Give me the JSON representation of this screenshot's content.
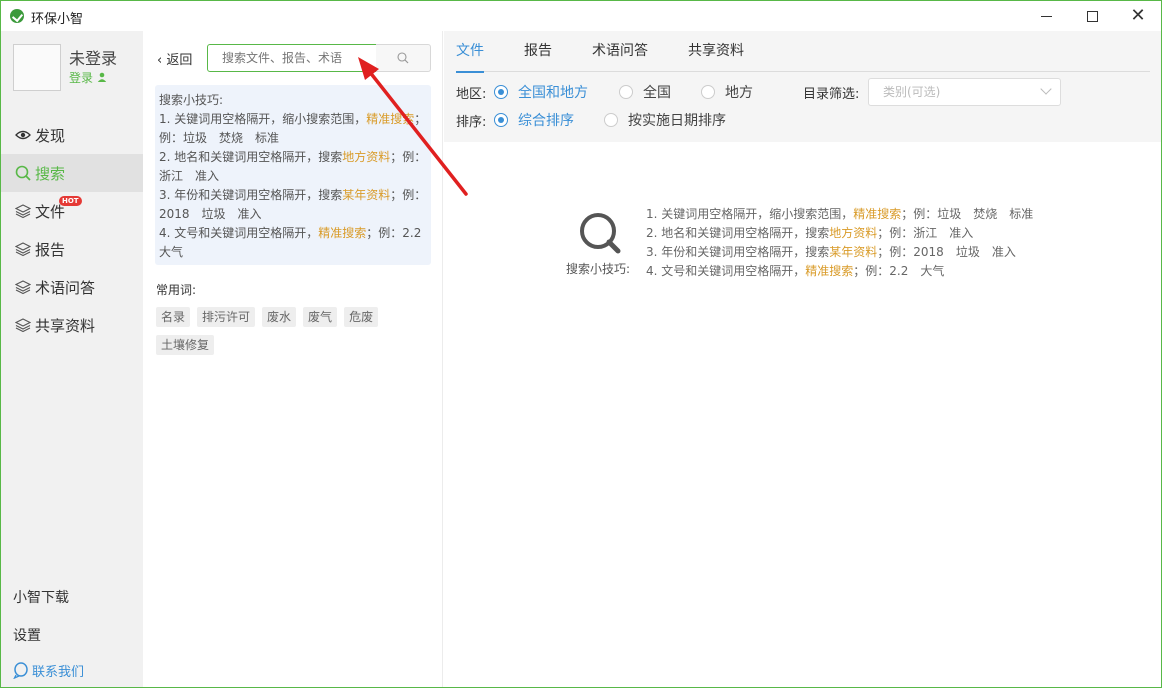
{
  "window": {
    "title": "环保小智"
  },
  "user": {
    "name": "未登录",
    "login_label": "登录"
  },
  "nav": [
    {
      "label": "发现",
      "icon": "eye-icon"
    },
    {
      "label": "搜索",
      "icon": "search-icon"
    },
    {
      "label": "文件",
      "icon": "layers-icon",
      "badge": "HOT"
    },
    {
      "label": "报告",
      "icon": "layers-icon"
    },
    {
      "label": "术语问答",
      "icon": "layers-icon"
    },
    {
      "label": "共享资料",
      "icon": "layers-icon"
    }
  ],
  "sidebar_bottom": {
    "download": "小智下载",
    "settings": "设置",
    "contact": "联系我们"
  },
  "search": {
    "back_label": "返回",
    "placeholder": "搜索文件、报告、术语"
  },
  "tips": {
    "title": "搜索小技巧:",
    "lines": [
      {
        "pre": "1. 关键词用空格隔开，缩小搜索范围，",
        "hl": "精准搜索",
        "post": "；例：垃圾　焚烧　标准"
      },
      {
        "pre": "2. 地名和关键词用空格隔开，搜索",
        "hl": "地方资料",
        "post": "；例：浙江　准入"
      },
      {
        "pre": "3. 年份和关键词用空格隔开，搜索",
        "hl": "某年资料",
        "post": "；例：2018　垃圾　准入"
      },
      {
        "pre": "4. 文号和关键词用空格隔开，",
        "hl": "精准搜索",
        "post": "；例：2.2　大气"
      }
    ]
  },
  "common_words": {
    "title": "常用词:",
    "items": [
      "名录",
      "排污许可",
      "废水",
      "废气",
      "危废",
      "土壤修复"
    ]
  },
  "tabs": [
    "文件",
    "报告",
    "术语问答",
    "共享资料"
  ],
  "filters": {
    "region_label": "地区:",
    "region_options": [
      "全国和地方",
      "全国",
      "地方"
    ],
    "region_selected": "全国和地方",
    "category_label": "目录筛选:",
    "category_placeholder": "类别(可选)",
    "sort_label": "排序:",
    "sort_options": [
      "综合排序",
      "按实施日期排序"
    ],
    "sort_selected": "综合排序"
  },
  "center_tips_label": "搜索小技巧:",
  "colors": {
    "accent_green": "#58b847",
    "accent_blue": "#3a8fd6",
    "highlight": "#d99b28",
    "arrow_red": "#e02020"
  }
}
